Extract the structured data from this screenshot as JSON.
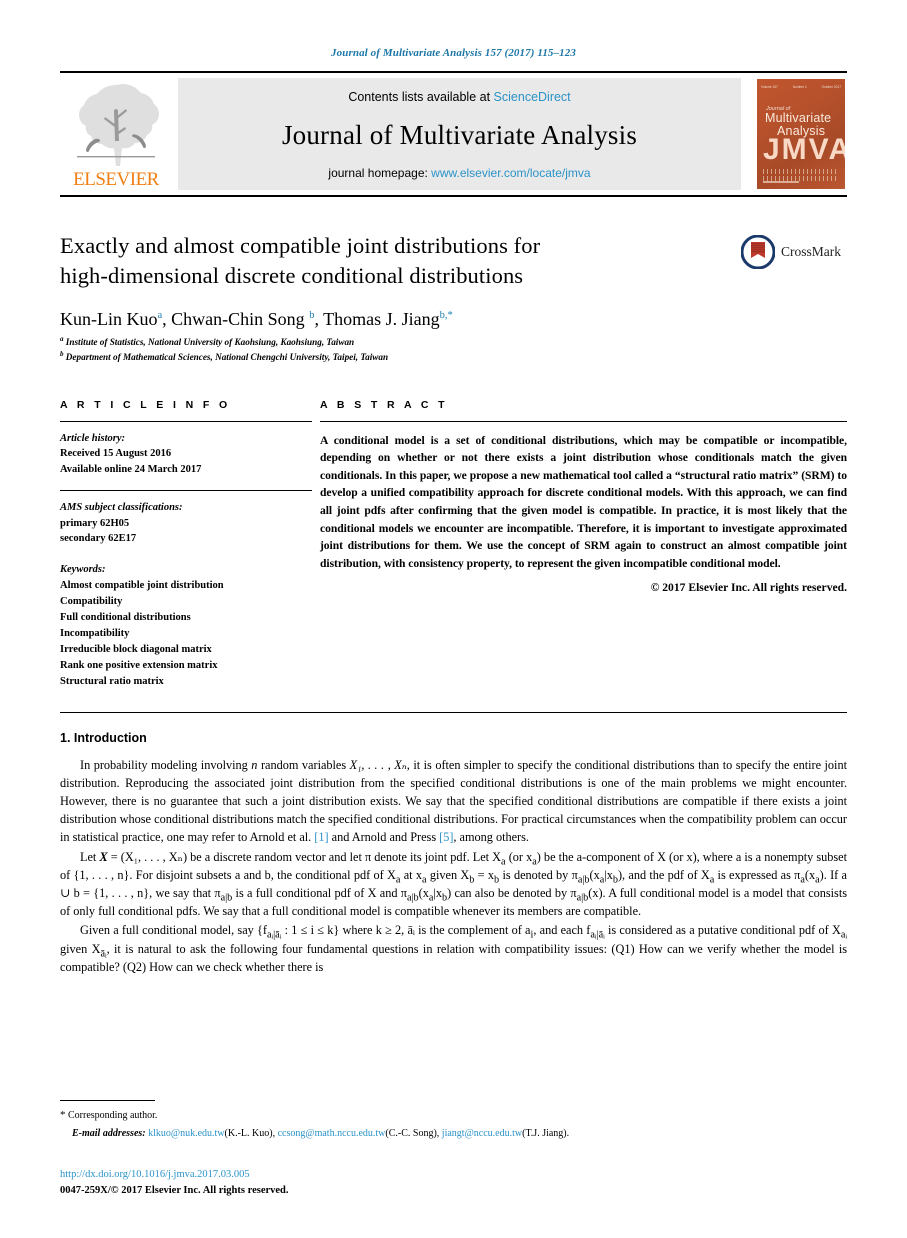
{
  "running_head": "Journal of Multivariate Analysis 157 (2017) 115–123",
  "masthead": {
    "contents_prefix": "Contents lists available at",
    "sciencedirect": "ScienceDirect",
    "journal_name": "Journal of Multivariate Analysis",
    "homepage_prefix": "journal homepage:",
    "homepage_url": "www.elsevier.com/locate/jmva",
    "publisher_wordmark": "ELSEVIER",
    "cover": {
      "top_left": "Volume 157",
      "top_mid": "Number 1",
      "top_right": "October 2017",
      "sub": "Journal of",
      "title_line1": "Multivariate",
      "title_line2": "Analysis",
      "acronym": "JMVA"
    }
  },
  "article": {
    "title_line1": "Exactly and almost compatible joint distributions for",
    "title_line2": "high-dimensional discrete conditional distributions",
    "crossmark_label": "CrossMark",
    "authors_html": "Kun-Lin Kuo<sup>a</sup>, Chwan-Chin Song <sup>b</sup>, Thomas J. Jiang<sup>b,*</sup>",
    "affiliation_a": "Institute of Statistics, National University of Kaohsiung, Kaohsiung, Taiwan",
    "affiliation_b": "Department of Mathematical Sciences, National Chengchi University, Taipei, Taiwan"
  },
  "info": {
    "heading": "A R T I C L E    I N F O",
    "history_label": "Article history:",
    "history": [
      "Received 15 August 2016",
      "Available online 24 March 2017"
    ],
    "ams_label": "AMS subject classifications:",
    "ams": [
      "primary 62H05",
      "secondary 62E17"
    ],
    "keywords_label": "Keywords:",
    "keywords": [
      "Almost compatible joint distribution",
      "Compatibility",
      "Full conditional distributions",
      "Incompatibility",
      "Irreducible block diagonal matrix",
      "Rank one positive extension matrix",
      "Structural ratio matrix"
    ]
  },
  "abstract": {
    "heading": "A B S T R A C T",
    "text": "A conditional model is a set of conditional distributions, which may be compatible or incompatible, depending on whether or not there exists a joint distribution whose conditionals match the given conditionals. In this paper, we propose a new mathematical tool called a “structural ratio matrix” (SRM) to develop a unified compatibility approach for discrete conditional models. With this approach, we can find all joint pdfs after confirming that the given model is compatible. In practice, it is most likely that the conditional models we encounter are incompatible. Therefore, it is important to investigate approximated joint distributions for them. We use the concept of SRM again to construct an almost compatible joint distribution, with consistency property, to represent the given incompatible conditional model.",
    "copyright": "© 2017 Elsevier Inc. All rights reserved."
  },
  "body": {
    "section_number_title": "1. Introduction",
    "para1_part1": "In probability modeling involving n random variables X",
    "para1": {
      "seg_a": "In probability modeling involving ",
      "n": "n",
      "seg_b": " random variables ",
      "vars": "X₁, . . . , Xₙ",
      "seg_c": ", it is often simpler to specify the conditional distributions than to specify the entire joint distribution. Reproducing the associated joint distribution from the specified conditional distributions is one of the main problems we might encounter. However, there is no guarantee that such a joint distribution exists. We say that the specified conditional distributions are compatible if there exists a joint distribution whose conditional distributions match the specified conditional distributions. For practical circumstances when the compatibility problem can occur in statistical practice, one may refer to Arnold et al. ",
      "cite1": "[1]",
      "seg_d": " and Arnold and Press ",
      "cite2": "[5]",
      "seg_e": ", among others."
    },
    "para2": {
      "seg_a": "Let ",
      "x_bold": "X",
      "seg_b": " = (X₁, . . . , Xₙ) be a discrete random vector and let π denote its joint pdf. Let X",
      "sub_a1": "a",
      "seg_c": " (or x",
      "sub_a2": "a",
      "seg_d": ") be the a-component of X (or x), where a is a nonempty subset of {1, . . . , n}. For disjoint subsets a and b, the conditional pdf of X",
      "sub_a3": "a",
      "seg_e": " at x",
      "sub_a4": "a",
      "seg_f": " given X",
      "sub_b1": "b",
      "seg_g": " = x",
      "sub_b2": "b",
      "seg_h": " is denoted by π",
      "sub_ab1": "a|b",
      "seg_i": "(x",
      "sub_a5": "a",
      "seg_j": "|x",
      "sub_b3": "b",
      "seg_k": "), and the pdf of X",
      "sub_a6": "a",
      "seg_l": " is expressed as π",
      "sub_a7": "a",
      "seg_m": "(x",
      "sub_a8": "a",
      "seg_n": "). If a ∪ b = {1, . . . , n}, we say that π",
      "sub_ab2": "a|b",
      "seg_o": " is a full conditional pdf of X and π",
      "sub_ab3": "a|b",
      "seg_p": "(x",
      "sub_a9": "a",
      "seg_q": "|x",
      "sub_b4": "b",
      "seg_r": ") can also be denoted by π",
      "sub_ab4": "a|b",
      "seg_s": "(x). A full conditional model is a model that consists of only full conditional pdfs. We say that a full conditional model is compatible whenever its members are compatible."
    },
    "para3": {
      "seg_a": "Given a full conditional model, say {f",
      "sub1": "aᵢ|āᵢ",
      "seg_b": " : 1 ≤ i ≤ k} where k ≥ 2, āᵢ is the complement of a",
      "sub2": "i",
      "seg_c": ", and each f",
      "sub3": "aᵢ|āᵢ",
      "seg_d": " is considered as a putative conditional pdf of X",
      "sub4": "aᵢ",
      "seg_e": " given X",
      "sub5": "āᵢ",
      "seg_f": ", it is natural to ask the following four fundamental questions in relation with compatibility issues: (Q1) How can we verify whether the model is compatible? (Q2) How can we check whether there is"
    }
  },
  "footer": {
    "corresponding_star": "*",
    "corresponding_text": "Corresponding author.",
    "email_label": "E-mail addresses:",
    "emails": [
      {
        "address": "klkuo@nuk.edu.tw",
        "person": "(K.-L. Kuo)"
      },
      {
        "address": "ccsong@math.nccu.edu.tw",
        "person": "(C.-C. Song)"
      },
      {
        "address": "jiangt@nccu.edu.tw",
        "person": "(T.J. Jiang)"
      }
    ],
    "doi": "http://dx.doi.org/10.1016/j.jmva.2017.03.005",
    "issn_line": "0047-259X/© 2017 Elsevier Inc. All rights reserved."
  },
  "colors": {
    "link_blue": "#2b93c8",
    "runhead_blue": "#1c77a8",
    "elsevier_orange": "#f07f13",
    "cover_orange": "#b6512c",
    "crossmark_blue": "#1b3a6b",
    "crossmark_red": "#c0392b"
  }
}
